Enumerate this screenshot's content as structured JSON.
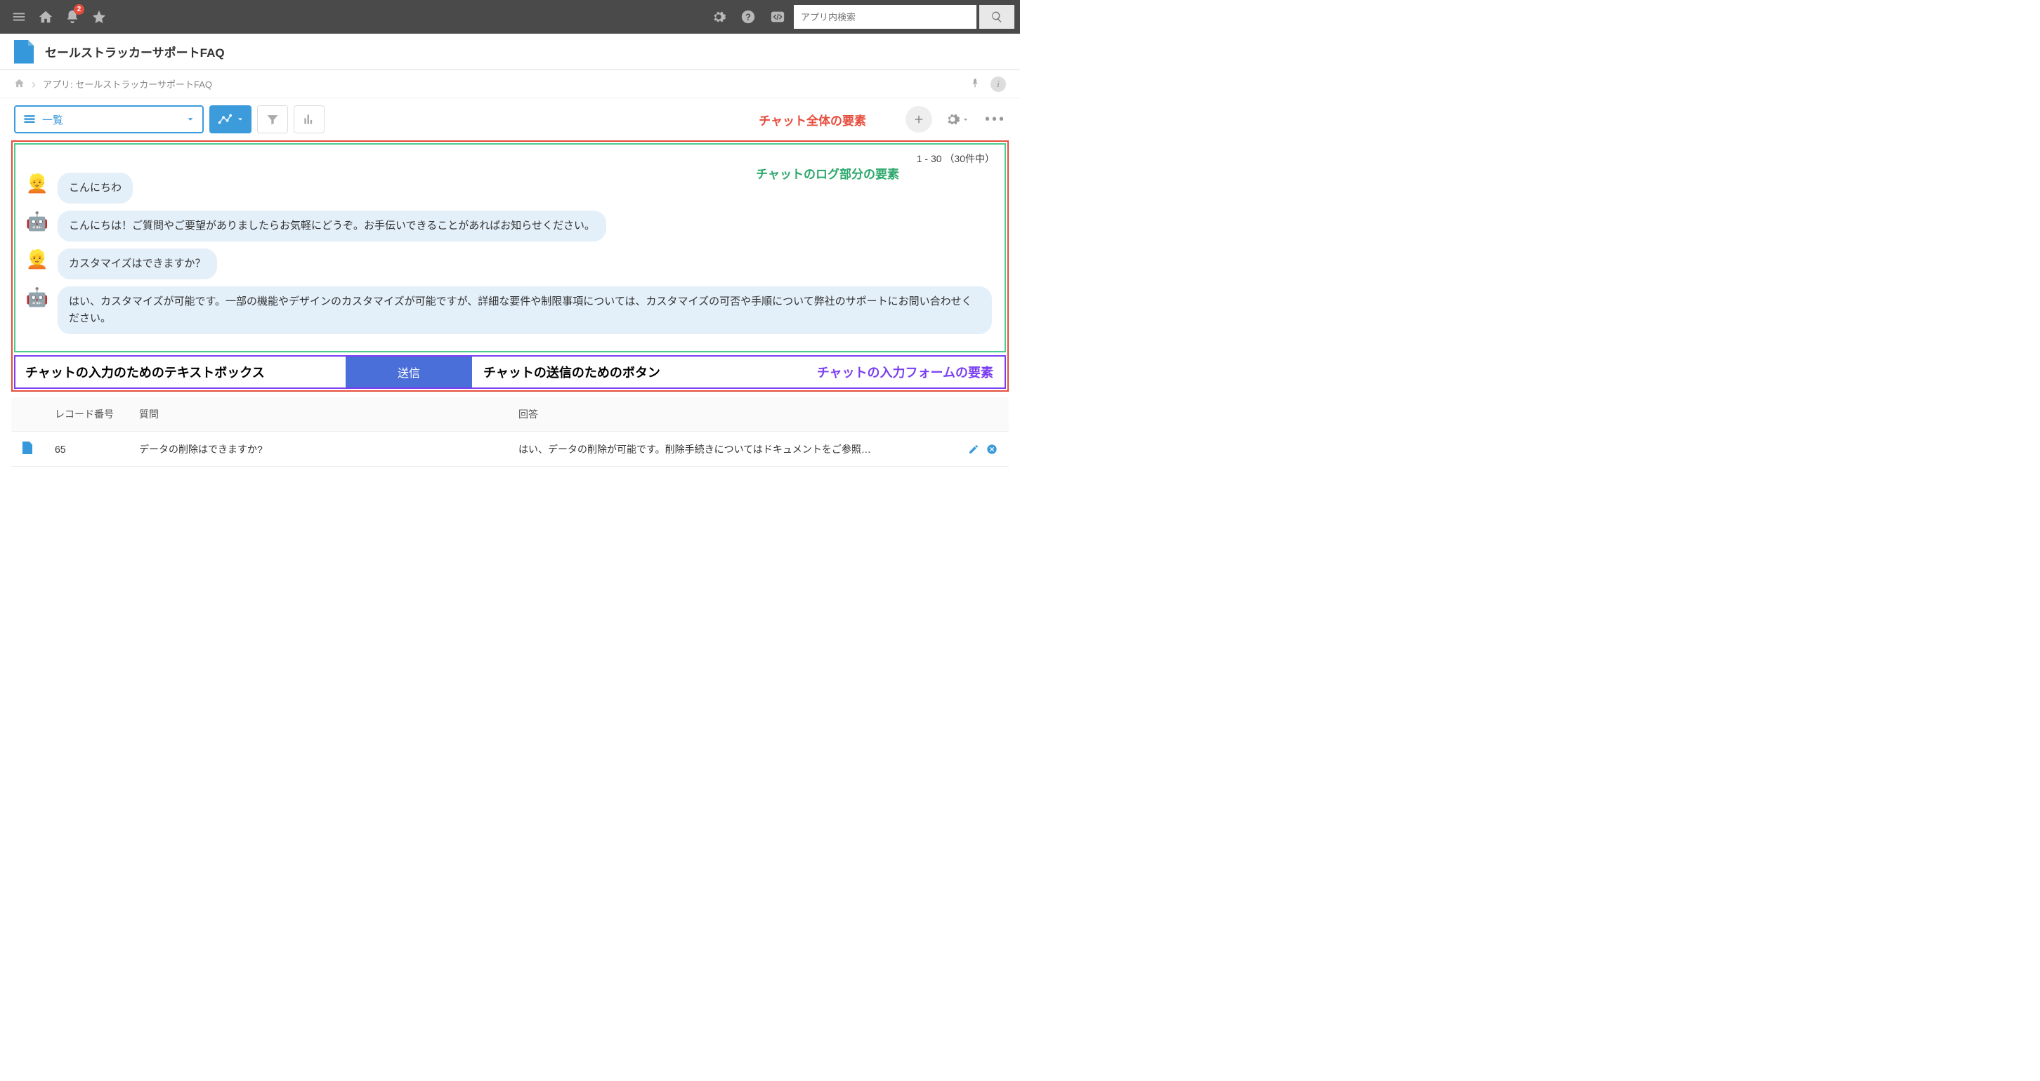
{
  "topbar": {
    "notification_count": "2",
    "search_placeholder": "アプリ内検索"
  },
  "app": {
    "title": "セールストラッカーサポートFAQ"
  },
  "breadcrumb": {
    "label": "アプリ: セールストラッカーサポートFAQ"
  },
  "toolbar": {
    "view_label": "一覧"
  },
  "annotations": {
    "chat_whole": "チャット全体の要素",
    "chat_log": "チャットのログ部分の要素",
    "chat_textbox": "チャットの入力のためのテキストボックス",
    "chat_send_button": "チャットの送信のためのボタン",
    "chat_form": "チャットの入力フォームの要素"
  },
  "chat": {
    "record_count": "1 - 30 （30件中）",
    "messages": [
      {
        "role": "user",
        "avatar": "👱",
        "text": "こんにちわ"
      },
      {
        "role": "bot",
        "avatar": "🤖",
        "text": "こんにちは！ご質問やご要望がありましたらお気軽にどうぞ。お手伝いできることがあればお知らせください。"
      },
      {
        "role": "user",
        "avatar": "👱",
        "text": "カスタマイズはできますか？"
      },
      {
        "role": "bot",
        "avatar": "🤖",
        "text": "はい、カスタマイズが可能です。一部の機能やデザインのカスタマイズが可能ですが、詳細な要件や制限事項については、カスタマイズの可否や手順について弊社のサポートにお問い合わせください。"
      }
    ],
    "send_label": "送信"
  },
  "table": {
    "headers": {
      "record_no": "レコード番号",
      "question": "質問",
      "answer": "回答"
    },
    "rows": [
      {
        "record_no": "65",
        "question": "データの削除はできますか?",
        "answer": "はい、データの削除が可能です。削除手続きについてはドキュメントをご参照…"
      }
    ]
  }
}
